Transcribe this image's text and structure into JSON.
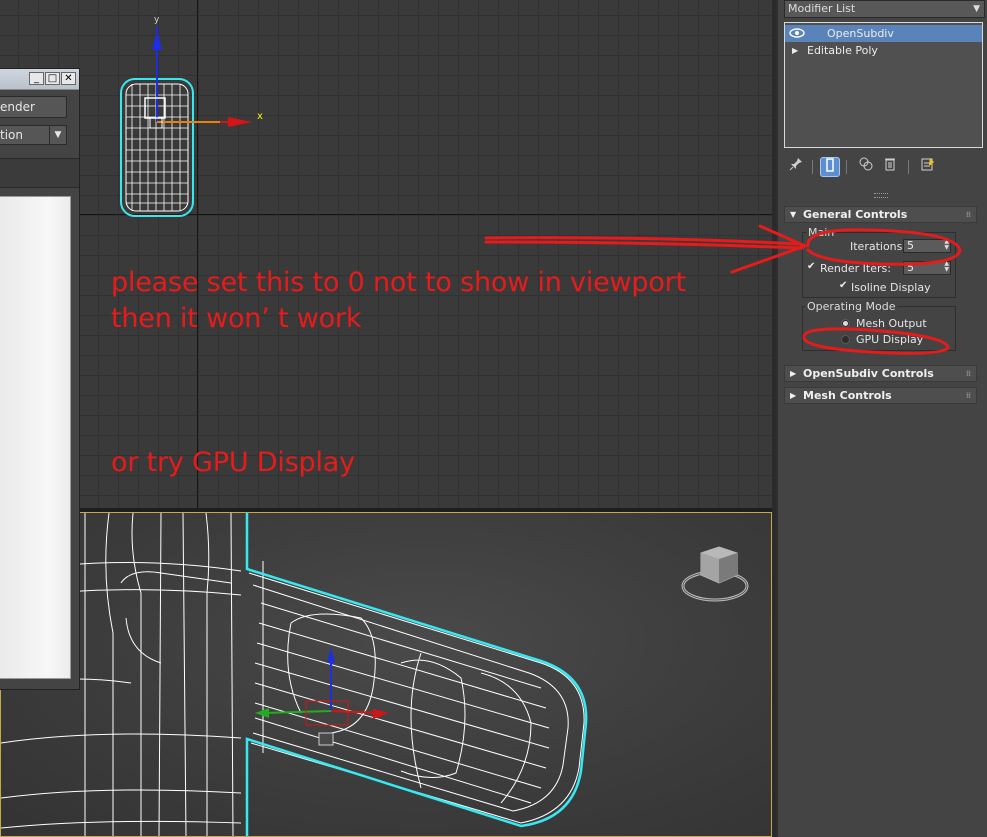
{
  "float_window": {
    "render_label": "Render",
    "render_visible": "ender",
    "dropdown_value": "tion",
    "min_glyph": "_",
    "max_glyph": "□",
    "close_glyph": "✕"
  },
  "viewport_top": {
    "axis_label": "x"
  },
  "command_panel": {
    "modifier_list_label": "Modifier List",
    "stack": [
      {
        "label": "OpenSubdiv",
        "selected": true
      },
      {
        "label": "Editable Poly",
        "selected": false
      }
    ],
    "toolbar": {
      "pin_icon": "pin-icon",
      "show_end_result_icon": "show-end-result-icon",
      "make_unique_icon": "make-unique-icon",
      "remove_modifier_icon": "trash-icon",
      "configure_icon": "configure-icon"
    },
    "rollouts": {
      "general_controls": {
        "title": "General Controls",
        "main_group": "Main",
        "iterations_label": "Iterations:",
        "iterations_value": "5",
        "render_iters_label": "Render Iters:",
        "render_iters_value": "5",
        "isoline_label": "Isoline Display",
        "operating_mode_group": "Operating Mode",
        "mode_mesh_output": "Mesh Output",
        "mode_gpu_display": "GPU Display"
      },
      "opensubdiv_controls": {
        "title": "OpenSubdiv Controls"
      },
      "mesh_controls": {
        "title": "Mesh Controls"
      }
    }
  },
  "annotations": {
    "line1": "please set this to 0 not to show in viewport",
    "line2": "then it won’ t work",
    "line3": "or try GPU Display",
    "color": "#e61b1b"
  },
  "colors": {
    "selection_wire": "#36e8f0",
    "stack_selected": "#5a84b9",
    "viewport_active_border": "#c8a94a"
  }
}
